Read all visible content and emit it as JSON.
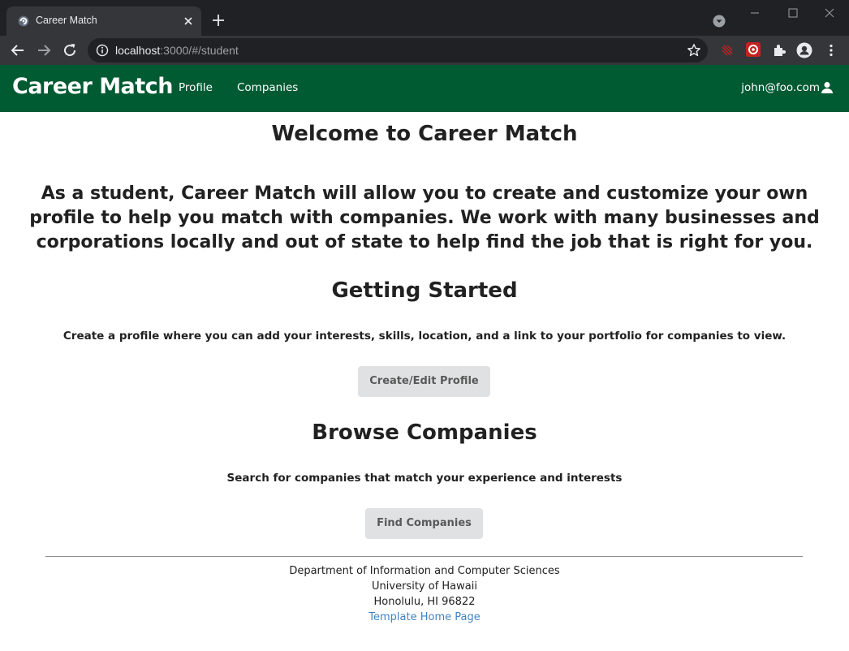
{
  "browser": {
    "tab_title": "Career Match",
    "url_host": "localhost",
    "url_path": ":3000/#/student"
  },
  "navbar": {
    "brand": "Career Match",
    "links": [
      "Profile",
      "Companies"
    ],
    "user_email": "john@foo.com"
  },
  "main": {
    "welcome_heading": "Welcome to Career Match",
    "intro": "As a student, Career Match will allow you to create and customize your own profile to help you match with companies. We work with many businesses and corporations locally and out of state to help find the job that is right for you.",
    "getting_started_heading": "Getting Started",
    "getting_started_text": "Create a profile where you can add your interests, skills, location, and a link to your portfolio for companies to view.",
    "create_profile_button": "Create/Edit Profile",
    "browse_heading": "Browse Companies",
    "browse_text": "Search for companies that match your experience and interests",
    "find_companies_button": "Find Companies"
  },
  "footer": {
    "line1": "Department of Information and Computer Sciences",
    "line2": "University of Hawaii",
    "line3": "Honolulu, HI 96822",
    "link": "Template Home Page"
  },
  "colors": {
    "navbar_bg": "#005a32",
    "button_bg": "#e0e1e2",
    "link": "#4183c4"
  },
  "icons": [
    "tab-favicon-icon",
    "close-icon",
    "plus-icon",
    "tab-search-icon",
    "back-arrow-icon",
    "forward-arrow-icon",
    "reload-icon",
    "info-icon",
    "star-icon",
    "extension-icon",
    "puzzle-icon",
    "profile-icon",
    "kebab-menu-icon",
    "user-icon"
  ]
}
